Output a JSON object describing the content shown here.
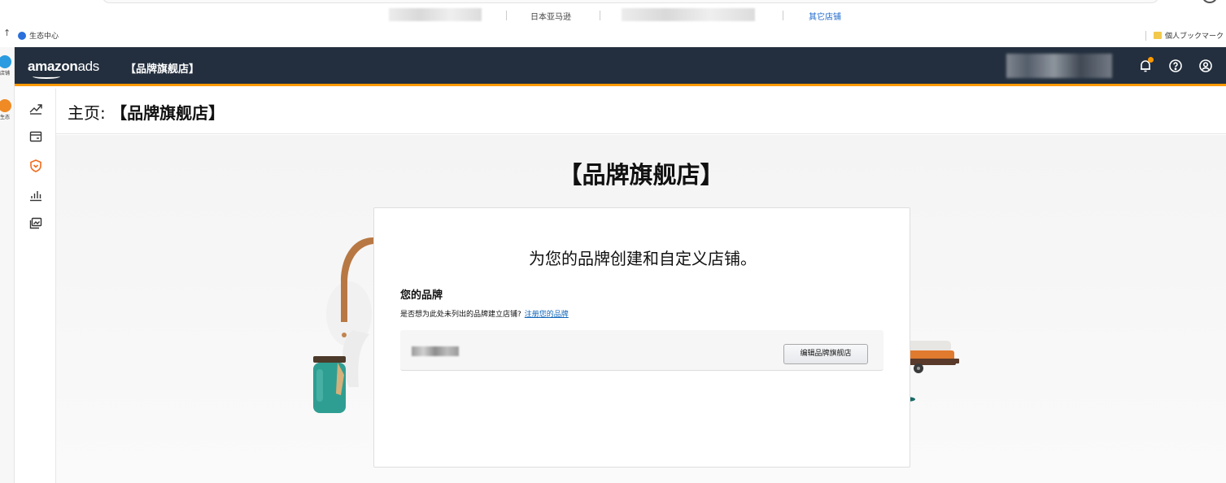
{
  "browser": {
    "tabs": [
      {
        "label": "日本亚马逊"
      },
      {
        "label": "其它店铺"
      }
    ],
    "bookmarks": {
      "left": "生态中心",
      "right": "個人ブックマーク"
    },
    "extensions": [
      {
        "label": "店铺",
        "color": "#2a9be0"
      },
      {
        "label": "生态",
        "color": "#f08a24"
      }
    ]
  },
  "header": {
    "logo_main": "amazon",
    "logo_ads": "ads",
    "store_name": "【品牌旗舰店】",
    "icons": [
      "bell-icon",
      "help-icon",
      "user-icon"
    ],
    "accent": "#ff9900",
    "bg": "#232f3e"
  },
  "leftnav": {
    "items": [
      "trend-icon",
      "wallet-icon",
      "shield-icon",
      "bar-chart-icon",
      "media-icon"
    ]
  },
  "page": {
    "title_prefix": "主页:",
    "title_name": "【品牌旗舰店】",
    "hero_title": "【品牌旗舰店】",
    "card": {
      "heading": "为您的品牌创建和自定义店铺。",
      "brand_label": "您的品牌",
      "brand_note": "是否想为此处未列出的品牌建立店铺?",
      "register_link": "注册您的品牌",
      "edit_button": "编辑品牌旗舰店"
    }
  }
}
